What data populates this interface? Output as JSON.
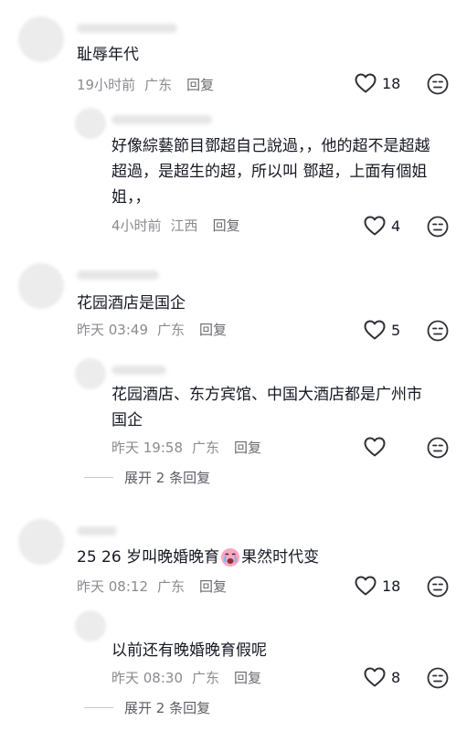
{
  "comments": [
    {
      "text": "耻辱年代",
      "time": "19小时前",
      "location": "广东",
      "reply_label": "回复",
      "likes": "18",
      "replies": [
        {
          "lines": [
            "好像綜藝節目鄧超自己說過，，他的超不是超越",
            "超過，是超生的超，所以叫 鄧超，上面有個姐",
            "姐，，"
          ],
          "time": "4小时前",
          "location": "江西",
          "reply_label": "回复",
          "likes": "4"
        }
      ]
    },
    {
      "text": "花园酒店是国企",
      "time": "昨天 03:49",
      "location": "广东",
      "reply_label": "回复",
      "likes": "5",
      "replies": [
        {
          "lines": [
            "花园酒店、东方宾馆、中国大酒店都是广州市",
            "国企"
          ],
          "time": "昨天 19:58",
          "location": "广东",
          "reply_label": "回复",
          "likes": ""
        }
      ],
      "expand_label": "展开 2 条回复"
    },
    {
      "text": "25 26 岁叫晚婚晚育",
      "text_after": "果然时代变",
      "emoji": "crying-face-emoji",
      "time": "昨天 08:12",
      "location": "广东",
      "reply_label": "回复",
      "likes": "18",
      "replies": [
        {
          "lines": [
            "以前还有晚婚晚育假呢"
          ],
          "time": "昨天 08:30",
          "location": "广东",
          "reply_label": "回复",
          "likes": "8"
        }
      ],
      "expand_label": "展开 2 条回复"
    }
  ],
  "icons": {
    "like": "heart-outline-icon",
    "dislike": "unamused-face-icon"
  },
  "colors": {
    "text": "#161823",
    "meta": "#8a8b91",
    "icon": "#2f3036",
    "emoji_pink": "#f7a8c0"
  }
}
